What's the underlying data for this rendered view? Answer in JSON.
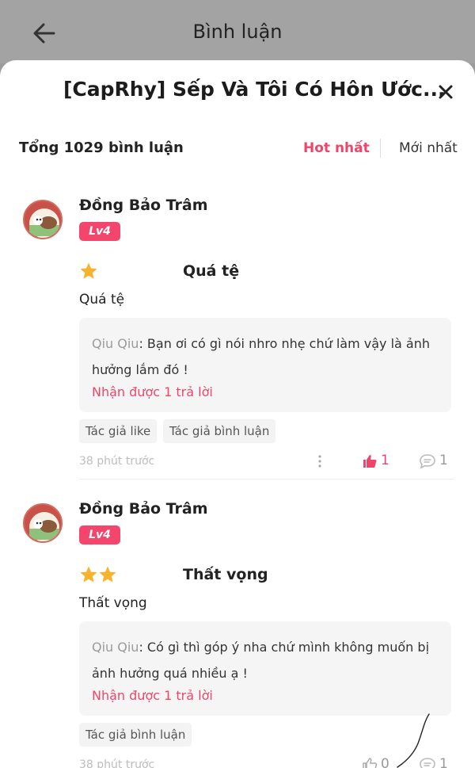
{
  "header": {
    "title": "Bình luận",
    "back_icon": "arrow-left-icon"
  },
  "sheet": {
    "title": "[CapRhy] Sếp Và Tôi Có Hôn Ước...",
    "close_icon": "close-icon"
  },
  "summary": {
    "total_label": "Tổng 1029 bình luận"
  },
  "sort": {
    "hot": "Hot nhất",
    "newest": "Mới nhất",
    "active": "hot"
  },
  "colors": {
    "accent": "#f0456b",
    "star": "#f7b32b"
  },
  "comments": [
    {
      "username": "Đồng Bảo Trâm",
      "level": "Lv4",
      "rating": 1,
      "rating_title": "Quá tệ",
      "text": "Quá tệ",
      "reply": {
        "name": "Qiu Qiu",
        "text": ": Bạn ơi có gì nói nhro nhẹ chứ làm vậy là ảnh hưởng lắm đó !",
        "count_label": "Nhận được 1 trả lời"
      },
      "tags": [
        "Tác giả like",
        "Tác giả bình luận"
      ],
      "time": "38 phút trước",
      "likes": "1",
      "liked": true,
      "comment_count": "1"
    },
    {
      "username": "Đồng Bảo Trâm",
      "level": "Lv4",
      "rating": 2,
      "rating_title": "Thất vọng",
      "text": "Thất vọng",
      "reply": {
        "name": "Qiu Qiu",
        "text": ": Có gì thì góp ý nha chứ mình không muốn bị ảnh hưởng quá nhiều ạ !",
        "count_label": "Nhận được 1 trả lời"
      },
      "tags": [
        "Tác giả bình luận"
      ],
      "time": "38 phút trước",
      "likes": "0",
      "liked": false,
      "comment_count": "1"
    }
  ]
}
